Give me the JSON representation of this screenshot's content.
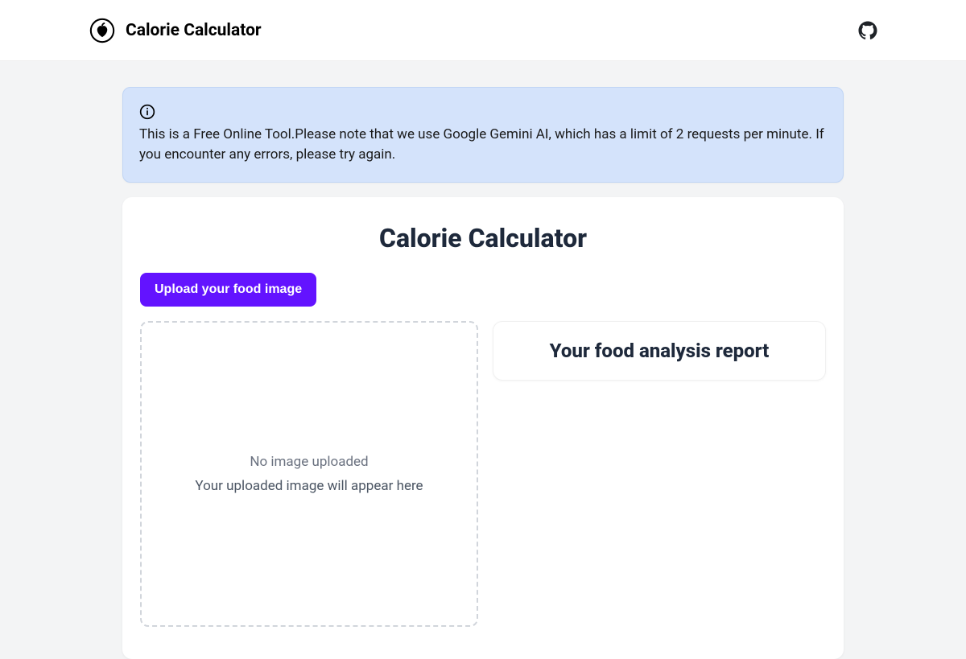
{
  "header": {
    "title": "Calorie Calculator"
  },
  "alert": {
    "text": "This is a Free Online Tool.Please note that we use Google Gemini AI, which has a limit of 2 requests per minute. If you encounter any errors, please try again."
  },
  "main": {
    "title": "Calorie Calculator",
    "upload_button_label": "Upload your food image",
    "dropzone": {
      "line1": "No image uploaded",
      "line2": "Your uploaded image will appear here"
    },
    "report": {
      "title": "Your food analysis report"
    }
  },
  "colors": {
    "accent": "#6313ff",
    "alert_bg": "#d4e3fb"
  }
}
